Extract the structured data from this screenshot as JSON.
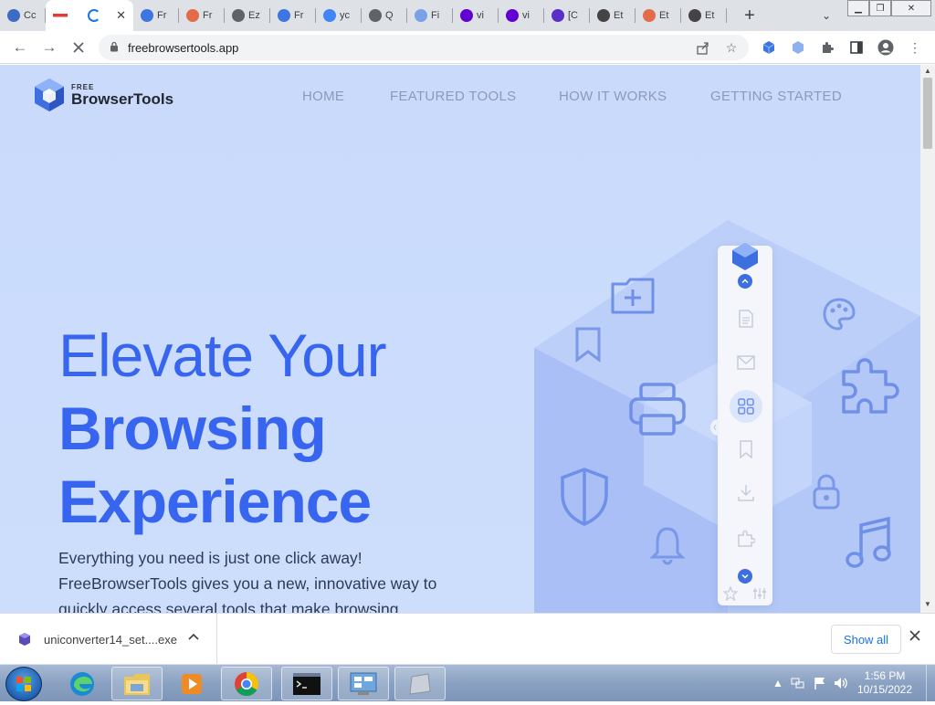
{
  "browser": {
    "tabs": [
      {
        "label": "Cc",
        "favicon": "chrome-circle-icon",
        "color": "#3c6cc4"
      },
      {
        "label": "",
        "favicon": "loading-spinner-icon",
        "color": "#1a73e8",
        "active": true
      },
      {
        "label": "Fr",
        "favicon": "cube-icon",
        "color": "#3d76e0"
      },
      {
        "label": "Fr",
        "favicon": "rainbow-icon",
        "color": "#e36b4a"
      },
      {
        "label": "Ez",
        "favicon": "globe-icon",
        "color": "#5f6368"
      },
      {
        "label": "Fr",
        "favicon": "cube-icon",
        "color": "#3d76e0"
      },
      {
        "label": "yc",
        "favicon": "google-g-icon",
        "color": "#4285f4"
      },
      {
        "label": "Q",
        "favicon": "search-icon",
        "color": "#5f6368"
      },
      {
        "label": "Fi",
        "favicon": "cube-icon",
        "color": "#7aa0e8"
      },
      {
        "label": "vi",
        "favicon": "yahoo-icon",
        "color": "#6001d2"
      },
      {
        "label": "vi",
        "favicon": "yahoo-icon",
        "color": "#6001d2"
      },
      {
        "label": "[C",
        "favicon": "bing-icon",
        "color": "#5a2fc9"
      },
      {
        "label": "Et",
        "favicon": "peace-hand-icon",
        "color": "#444"
      },
      {
        "label": "Et",
        "favicon": "rainbow-icon",
        "color": "#e36b4a"
      },
      {
        "label": "Et",
        "favicon": "peace-hand-icon",
        "color": "#444"
      }
    ],
    "new_tab_symbol": "+",
    "tab_close_symbol": "✕",
    "url": "freebrowsertools.app",
    "back_symbol": "←",
    "forward_symbol": "→",
    "stop_symbol": "✕"
  },
  "site": {
    "logo_small": "FREE",
    "logo_big": "BrowserTools",
    "nav": [
      "HOME",
      "FEATURED TOOLS",
      "HOW IT WORKS",
      "GETTING STARTED"
    ],
    "hero_line1": "Elevate Your",
    "hero_line2": "Browsing",
    "hero_line3": "Experience",
    "hero_desc": "Everything you need is just one click away! FreeBrowserTools gives you a new, innovative way to quickly access several tools that make browsing",
    "colors": {
      "accent": "#3765f0",
      "bg": "#c9dafb",
      "icon": "#6f8fe8"
    }
  },
  "download_bar": {
    "file_name": "uniconverter14_set....exe",
    "show_all": "Show all"
  },
  "taskbar": {
    "time": "1:56 PM",
    "date": "10/15/2022"
  }
}
